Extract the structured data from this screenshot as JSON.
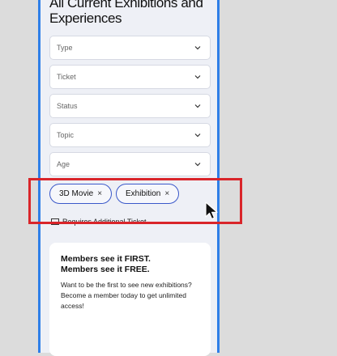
{
  "page": {
    "title_line1": "All Current Exhibitions and",
    "title_line2": "Experiences"
  },
  "filters": [
    {
      "label": "Type"
    },
    {
      "label": "Ticket"
    },
    {
      "label": "Status"
    },
    {
      "label": "Topic"
    },
    {
      "label": "Age"
    }
  ],
  "chips": [
    {
      "label": "3D Movie",
      "remove_glyph": "×"
    },
    {
      "label": "Exhibition",
      "remove_glyph": "×"
    }
  ],
  "checkbox": {
    "label": "Requires Additional Ticket"
  },
  "promo": {
    "heading_line1": "Members see it FIRST.",
    "heading_line2": "Members see it FREE.",
    "body": "Want to be the first to see new exhibitions? Become a member today to get unlimited access!"
  },
  "icons": {
    "chevron": "chevron-down-icon",
    "cursor": "pointer-cursor-icon"
  },
  "colors": {
    "accent": "#2f7fe8",
    "chip_border": "#3a58c9",
    "highlight": "#d9252a",
    "bg": "#eef0f6"
  }
}
